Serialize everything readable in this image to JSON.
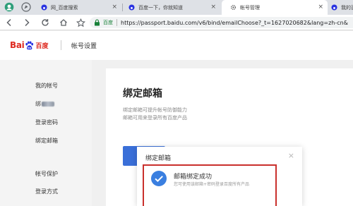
{
  "browser": {
    "tabs": [
      {
        "title": "网_百度搜索",
        "close": "×",
        "active": false
      },
      {
        "title": "百度一下，你就知道",
        "close": "×",
        "active": false
      },
      {
        "title": "帐号管理",
        "close": "×",
        "active": true
      },
      {
        "title": "我的百",
        "close": "",
        "active": false
      }
    ],
    "site_chip": "百度",
    "url": "https://passport.baidu.com/v6/bind/emailChoose?_t=1627020682&lang=zh-cn&",
    "nav_icons": [
      "back-icon",
      "forward-icon",
      "reload-icon",
      "home-icon",
      "bookmark-star-icon"
    ],
    "accent": "#1a73e8"
  },
  "header": {
    "logo_left": "Bai",
    "logo_right": "百度",
    "title": "帐号设置",
    "brand_color": "#de2a20"
  },
  "sidebar": {
    "items": [
      {
        "label": "我的帐号"
      },
      {
        "label": "绑"
      },
      {
        "label": "登录密码"
      },
      {
        "label": "绑定邮箱"
      },
      {
        "label": "帐号保护"
      },
      {
        "label": "登录方式"
      }
    ]
  },
  "main": {
    "title": "绑定邮箱",
    "desc_line1": "绑定邮箱可提升帐号防御能力",
    "desc_line2": "邮箱可用来登录所有百度产品",
    "button_color": "#3a6fd8"
  },
  "dialog": {
    "title": "绑定邮箱",
    "close": "×",
    "success_title": "邮箱绑定成功",
    "success_sub": "您可使用该邮箱+密码登录百度所有产品",
    "highlight_color": "#c9302c",
    "check_color": "#3a7fe0"
  }
}
